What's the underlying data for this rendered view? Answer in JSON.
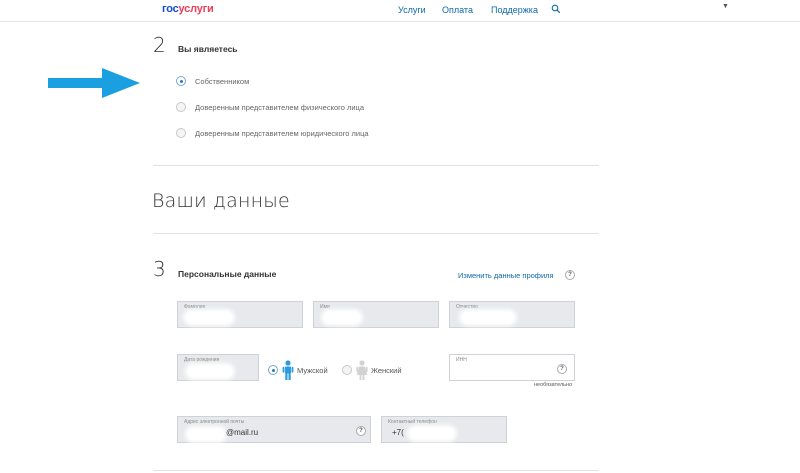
{
  "header": {
    "logo": {
      "part1": "гос",
      "part2": "услуги"
    },
    "nav": [
      "Услуги",
      "Оплата",
      "Поддержка"
    ],
    "search_icon": "search-icon",
    "user_menu_icon": "caret-down-icon"
  },
  "colors": {
    "accent": "#0d6aa8",
    "arrow": "#1aa0e0",
    "field_bg": "#e7e9ec",
    "logo_blue": "#0d4cd3",
    "logo_red": "#ee3f58"
  },
  "step2": {
    "number": "2",
    "title": "Вы являетесь",
    "options": [
      {
        "label": "Собственником",
        "selected": true
      },
      {
        "label": "Доверенным представителем физического лица",
        "selected": false
      },
      {
        "label": "Доверенным представителем юридического лица",
        "selected": false
      }
    ]
  },
  "section_title": "Ваши данные",
  "step3": {
    "number": "3",
    "title": "Персональные данные",
    "edit_link": "Изменить данные профиля",
    "help": "?",
    "fields": {
      "surname": {
        "label": "Фамилия"
      },
      "name": {
        "label": "Имя"
      },
      "patronymic": {
        "label": "Отчество"
      },
      "birthdate": {
        "label": "Дата рождения"
      },
      "inn": {
        "label": "ИНН",
        "note": "необязательно"
      },
      "email": {
        "label": "Адрес электронной почты",
        "value": "@mail.ru"
      },
      "phone": {
        "label": "Контактный телефон",
        "value": "+7("
      }
    },
    "gender": {
      "male": {
        "label": "Мужской",
        "selected": true
      },
      "female": {
        "label": "Женский",
        "selected": false
      }
    }
  }
}
